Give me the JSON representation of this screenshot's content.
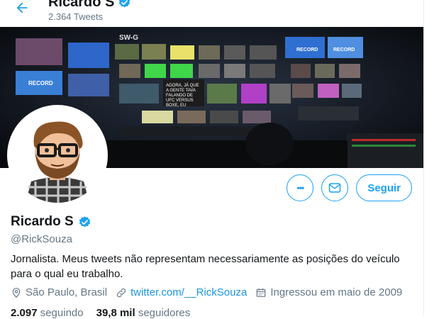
{
  "header": {
    "name": "Ricardo S",
    "tweet_count": "2.364 Tweets"
  },
  "banner": {
    "monitor_labels": [
      "SW-G",
      "RECORD",
      "RECORD",
      "RECORD"
    ],
    "caption_lines": [
      "AGORA, JÁ QUE",
      "A GENTE TAVA",
      "FALANDO DE",
      "UFC VERSUS",
      "BOXE, EU"
    ]
  },
  "actions": {
    "more_label": "•••",
    "follow_label": "Seguir"
  },
  "profile": {
    "name": "Ricardo S",
    "handle": "@RickSouza",
    "bio": "Jornalista. Meus tweets não representam necessariamente as posições do veículo para o qual eu trabalho.",
    "location": "São Paulo, Brasil",
    "website": "twitter.com/__RickSouza",
    "joined": "Ingressou em maio de 2009"
  },
  "counts": {
    "following_value": "2.097",
    "following_label": "seguindo",
    "followers_value": "39,8 mil",
    "followers_label": "seguidores"
  },
  "colors": {
    "accent": "#1da1f2",
    "link": "#1b95e0",
    "muted": "#657786"
  }
}
